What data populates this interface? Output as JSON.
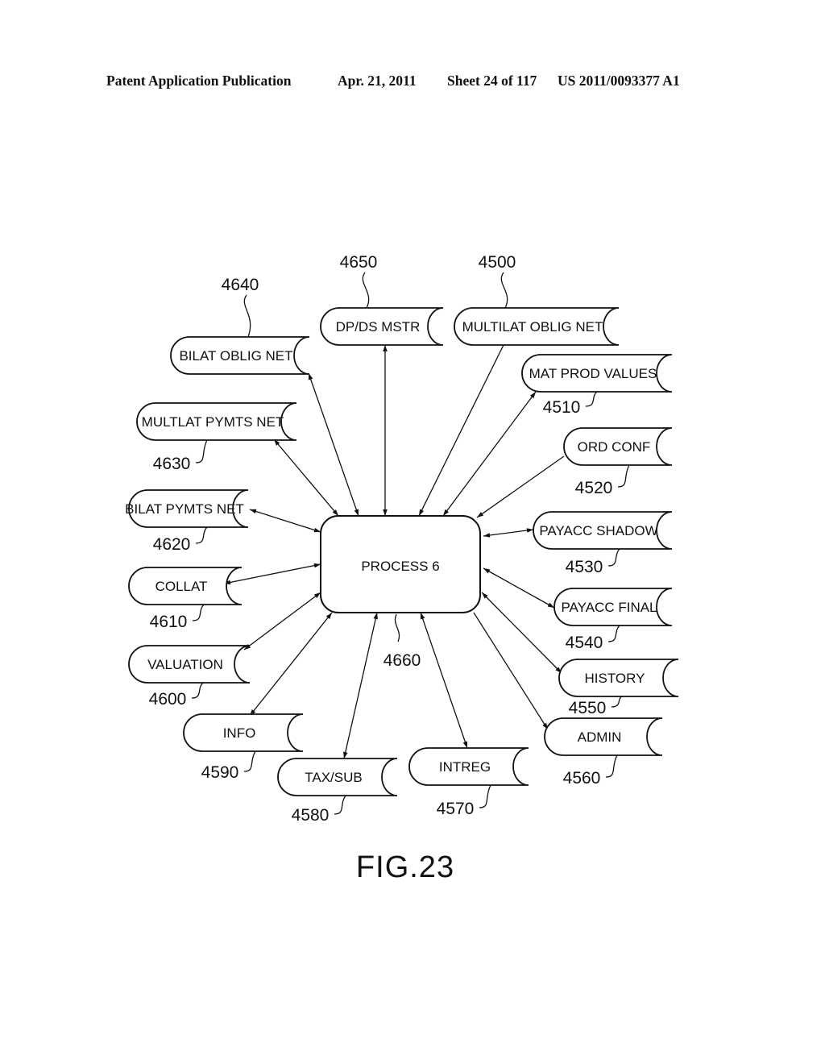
{
  "header": {
    "publication": "Patent Application Publication",
    "date": "Apr. 21, 2011",
    "sheet": "Sheet 24 of 117",
    "number": "US 2011/0093377 A1"
  },
  "figure_label": "FIG.23",
  "process": {
    "label": "PROCESS 6",
    "ref": "4660"
  },
  "stores": [
    {
      "id": "4640",
      "label": "BILAT OBLIG NET",
      "arrow": "both"
    },
    {
      "id": "4650",
      "label": "DP/DS MSTR",
      "arrow": "both"
    },
    {
      "id": "4500",
      "label": "MULTILAT OBLIG NET",
      "arrow": "to-process"
    },
    {
      "id": "4510",
      "label": "MAT PROD VALUES",
      "arrow": "both"
    },
    {
      "id": "4520",
      "label": "ORD CONF",
      "arrow": "to-process"
    },
    {
      "id": "4530",
      "label": "PAYACC SHADOW",
      "arrow": "both"
    },
    {
      "id": "4540",
      "label": "PAYACC FINAL",
      "arrow": "both"
    },
    {
      "id": "4550",
      "label": "HISTORY",
      "arrow": "both"
    },
    {
      "id": "4560",
      "label": "ADMIN",
      "arrow": "from-process"
    },
    {
      "id": "4570",
      "label": "INTREG",
      "arrow": "both"
    },
    {
      "id": "4580",
      "label": "TAX/SUB",
      "arrow": "both"
    },
    {
      "id": "4590",
      "label": "INFO",
      "arrow": "both"
    },
    {
      "id": "4600",
      "label": "VALUATION",
      "arrow": "both"
    },
    {
      "id": "4610",
      "label": "COLLAT",
      "arrow": "both"
    },
    {
      "id": "4620",
      "label": "BILAT PYMTS NET",
      "arrow": "both"
    },
    {
      "id": "4630",
      "label": "MULTLAT PYMTS NET",
      "arrow": "both"
    }
  ]
}
